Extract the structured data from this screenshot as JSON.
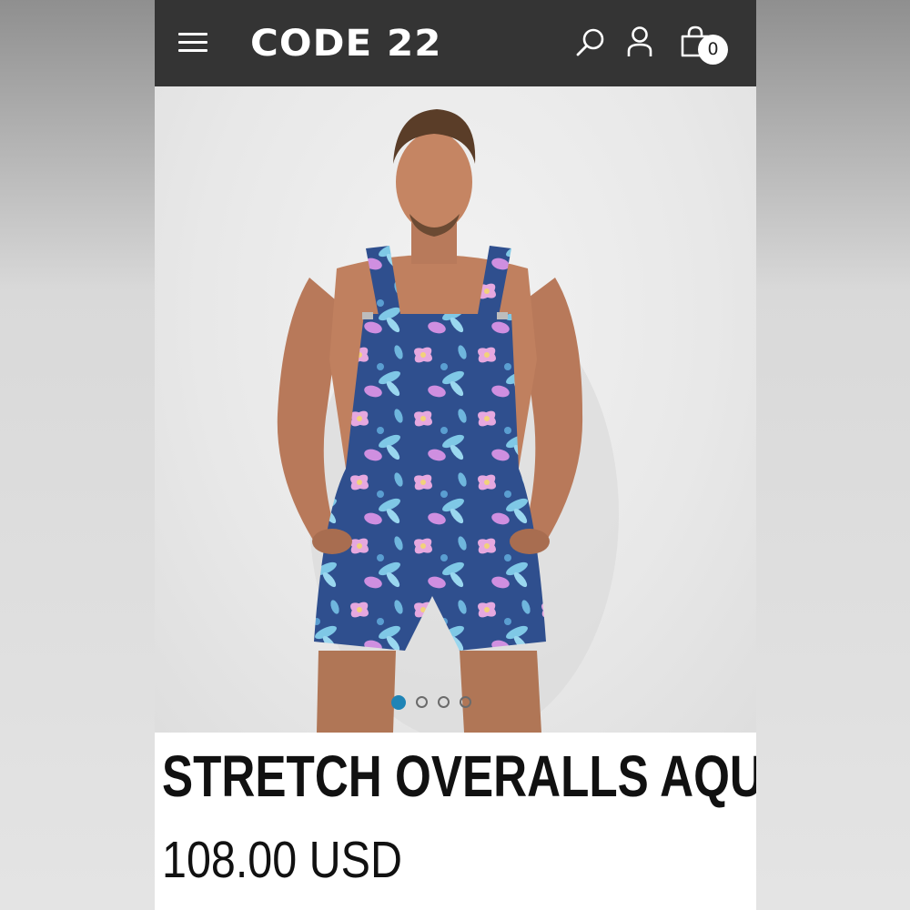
{
  "header": {
    "logo_text": "CODE 22",
    "cart_count": "0",
    "background_color": "#343434"
  },
  "icons": {
    "menu": "hamburger-menu-icon",
    "search": "search-icon",
    "account": "user-icon",
    "cart": "shopping-bag-icon"
  },
  "gallery": {
    "image_count": 4,
    "active_index": 0,
    "active_dot_color": "#1f84b6"
  },
  "product": {
    "title": "STRETCH OVERALLS AQUA",
    "price": "108.00 USD"
  }
}
